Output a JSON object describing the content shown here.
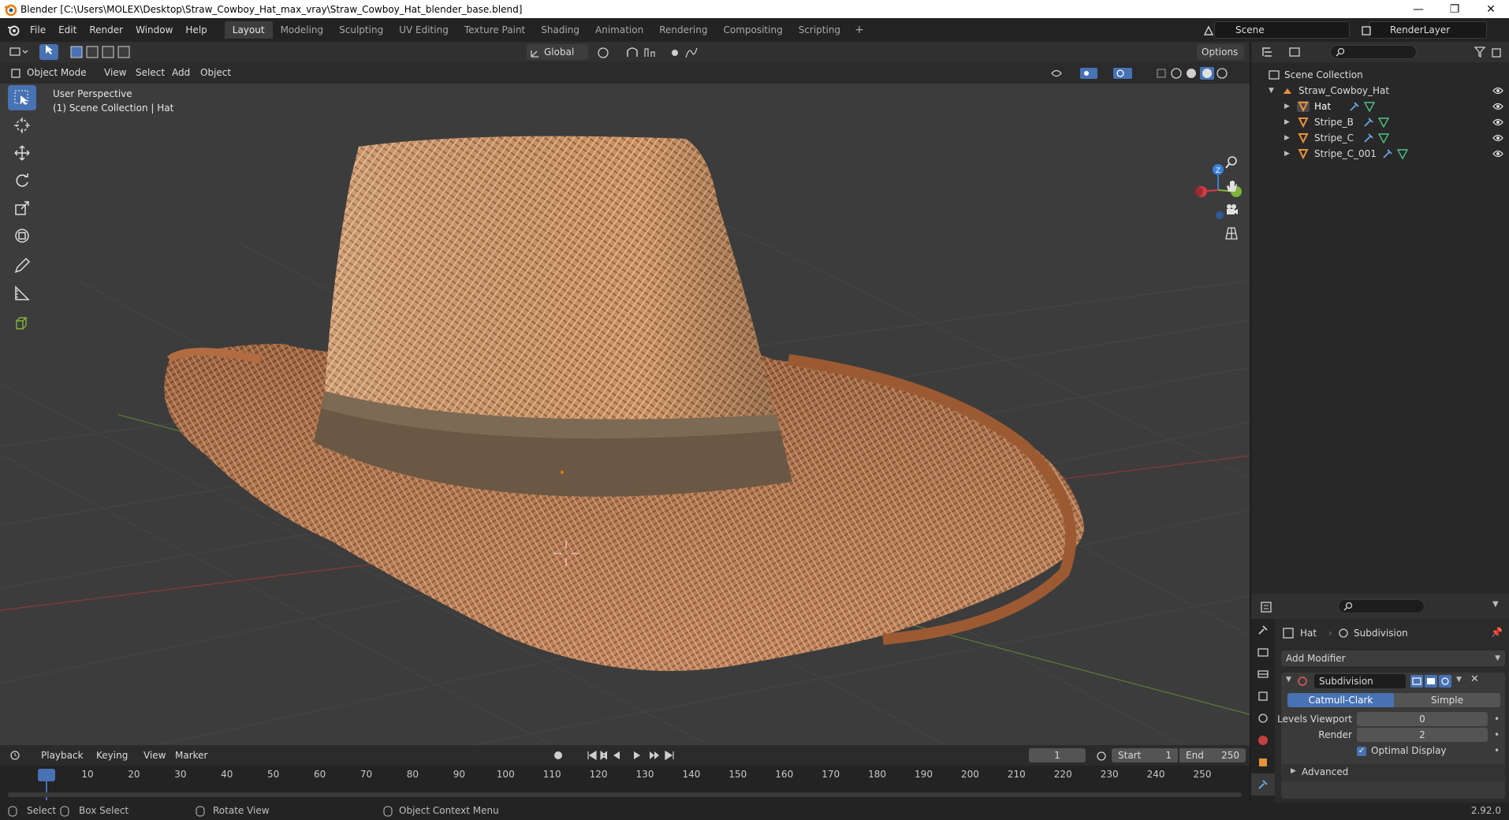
{
  "window": {
    "title": "Blender [C:\\Users\\MOLEX\\Desktop\\Straw_Cowboy_Hat_max_vray\\Straw_Cowboy_Hat_blender_base.blend]",
    "minimize": "—",
    "maximize": "❐",
    "close": "✕"
  },
  "menu": [
    "File",
    "Edit",
    "Render",
    "Window",
    "Help"
  ],
  "workspaces": [
    "Layout",
    "Modeling",
    "Sculpting",
    "UV Editing",
    "Texture Paint",
    "Shading",
    "Animation",
    "Rendering",
    "Compositing",
    "Scripting"
  ],
  "active_workspace": "Layout",
  "workspace_add": "+",
  "scene": {
    "name": "Scene",
    "render_layer": "RenderLayer"
  },
  "viewport_header": {
    "transform_orientation": "Global",
    "options": "Options",
    "mode": "Object Mode",
    "menus": [
      "View",
      "Select",
      "Add",
      "Object"
    ]
  },
  "viewport": {
    "perspective": "User Perspective",
    "collection_info": "(1) Scene Collection | Hat",
    "gizmo_axes": {
      "x": "X",
      "y": "Y",
      "z": "Z"
    }
  },
  "outliner": {
    "root": "Scene Collection",
    "collection": "Straw_Cowboy_Hat",
    "objects": [
      {
        "name": "Hat",
        "selected": true
      },
      {
        "name": "Stripe_B",
        "selected": false
      },
      {
        "name": "Stripe_C",
        "selected": false
      },
      {
        "name": "Stripe_C_001",
        "selected": false
      }
    ]
  },
  "properties": {
    "object_name": "Hat",
    "modifier_context": "Subdivision",
    "add_modifier": "Add Modifier",
    "modifier": {
      "name": "Subdivision",
      "type_options": [
        "Catmull-Clark",
        "Simple"
      ],
      "selected_type": "Catmull-Clark",
      "levels_viewport_label": "Levels Viewport",
      "levels_viewport": "0",
      "render_label": "Render",
      "render": "2",
      "optimal_display_label": "Optimal Display",
      "optimal_display": true,
      "advanced_label": "Advanced"
    }
  },
  "timeline": {
    "menus": [
      "Playback",
      "Keying",
      "View",
      "Marker"
    ],
    "current_frame": "1",
    "start_label": "Start",
    "start": "1",
    "end_label": "End",
    "end": "250",
    "ruler_ticks": [
      "1",
      "10",
      "20",
      "30",
      "40",
      "50",
      "60",
      "70",
      "80",
      "90",
      "100",
      "110",
      "120",
      "130",
      "140",
      "150",
      "160",
      "170",
      "180",
      "190",
      "200",
      "210",
      "220",
      "230",
      "240",
      "250"
    ]
  },
  "status_bar": {
    "select": "Select",
    "box_select": "Box Select",
    "rotate_view": "Rotate View",
    "context_menu": "Object Context Menu",
    "version": "2.92.0"
  },
  "colors": {
    "accent": "#4772b3",
    "axis_x": "#d73a45",
    "axis_y": "#7fb43a",
    "axis_z": "#3a7fd7",
    "hat_light": "#d9a777",
    "hat_dark": "#8a4f2a",
    "band": "#6a5844"
  }
}
